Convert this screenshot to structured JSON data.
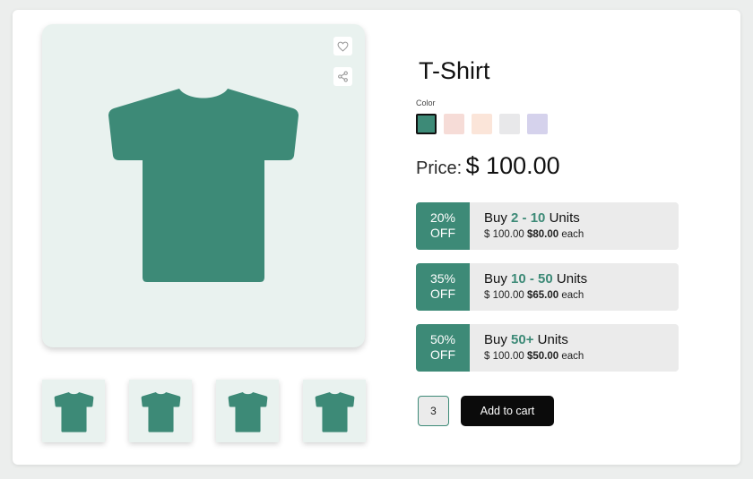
{
  "product": {
    "title": "T-Shirt",
    "color_label": "Color",
    "colors": [
      "#3d8a77",
      "#f6dcd7",
      "#fbe5d9",
      "#e8e8ea",
      "#d5d2ec"
    ],
    "selected_color_index": 0,
    "price_label": "Price:",
    "price_value": "$ 100.00",
    "shirt_color": "#3d8a77"
  },
  "icons": {
    "favorite": "heart-icon",
    "share": "share-icon"
  },
  "tiers": [
    {
      "pct": "20%",
      "off": "OFF",
      "buy": "Buy",
      "range": "2 - 10",
      "units": "Units",
      "orig": "$ 100.00",
      "price": "$80.00",
      "each": "each"
    },
    {
      "pct": "35%",
      "off": "OFF",
      "buy": "Buy",
      "range": "10 - 50",
      "units": "Units",
      "orig": "$ 100.00",
      "price": "$65.00",
      "each": "each"
    },
    {
      "pct": "50%",
      "off": "OFF",
      "buy": "Buy",
      "range": "50+",
      "units": "Units",
      "orig": "$ 100.00",
      "price": "$50.00",
      "each": "each"
    }
  ],
  "cart": {
    "quantity": "3",
    "add_label": "Add to cart"
  }
}
